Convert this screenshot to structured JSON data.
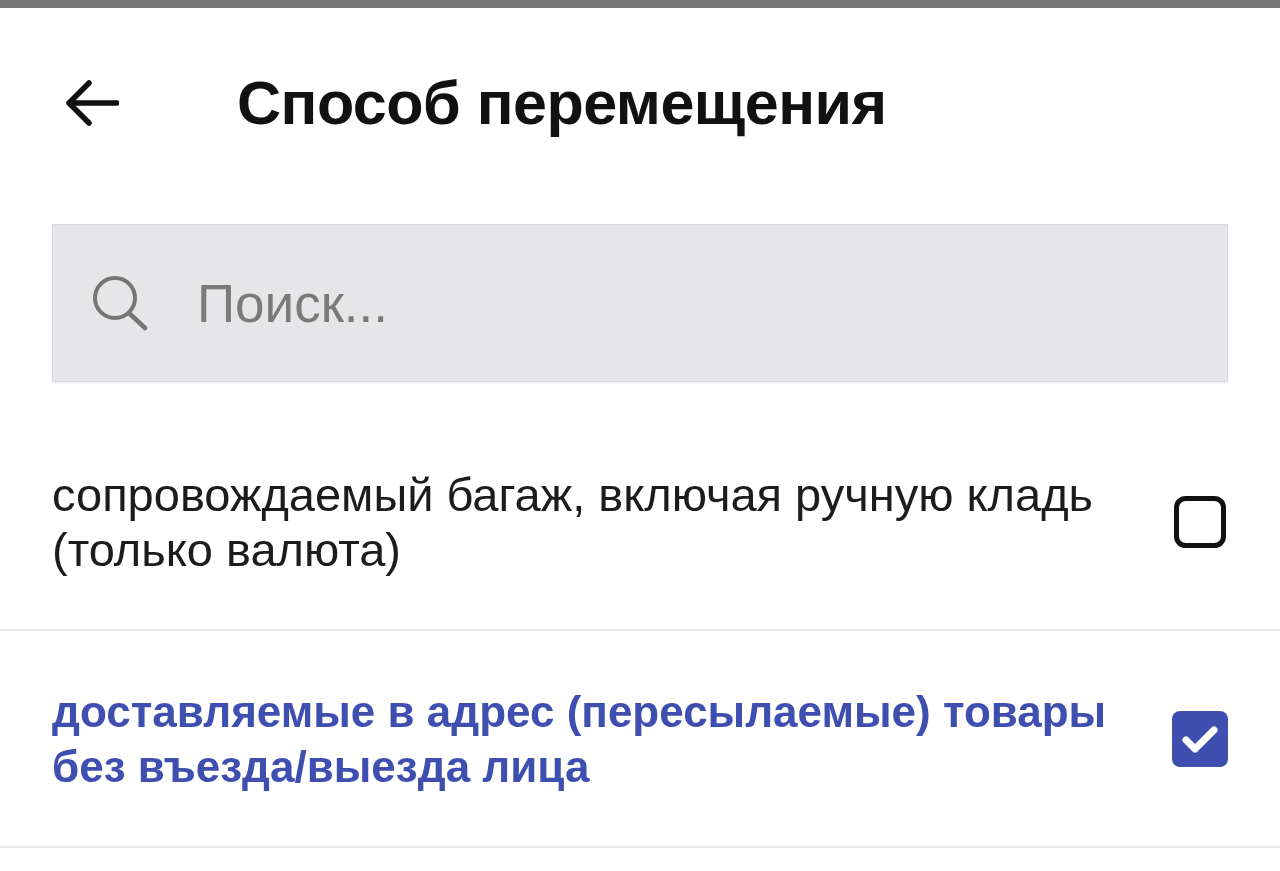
{
  "header": {
    "title": "Способ перемещения"
  },
  "search": {
    "placeholder": "Поиск..."
  },
  "options": [
    {
      "label": "сопровождаемый багаж, включая ручную кладь (только валюта)",
      "checked": false
    },
    {
      "label": "доставляемые в адрес (пересылаемые) товары без въезда/выезда лица",
      "checked": true
    }
  ]
}
